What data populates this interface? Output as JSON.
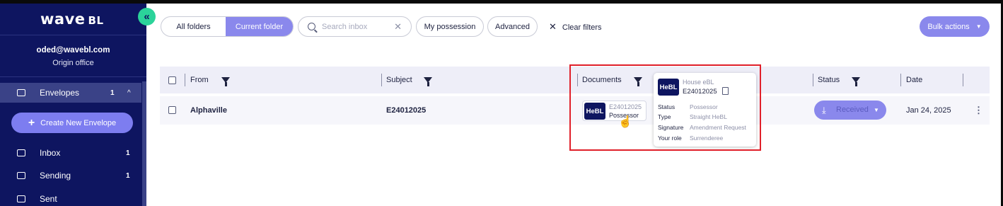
{
  "sidebar": {
    "logo": "wave",
    "logo_suffix": "BL",
    "collapse_icon": "double-chevron-left-icon",
    "user_email": "oded@wavebl.com",
    "user_role": "Origin office",
    "items": [
      {
        "label": "Envelopes",
        "count": "1",
        "icon": "envelope-icon",
        "expanded_indicator": "^"
      },
      {
        "label": "Inbox",
        "count": "1",
        "icon": "inbox-icon"
      },
      {
        "label": "Sending",
        "count": "1",
        "icon": "send-icon"
      },
      {
        "label": "Sent",
        "count": "",
        "icon": "sent-icon"
      }
    ],
    "create_button": "Create New Envelope"
  },
  "toolbar": {
    "all_folders": "All folders",
    "current_folder": "Current folder",
    "search_placeholder": "Search inbox",
    "my_possession": "My possession",
    "advanced": "Advanced",
    "clear_filters": "Clear filters",
    "bulk_actions": "Bulk actions"
  },
  "table": {
    "headers": [
      "From",
      "Subject",
      "Documents",
      "Status",
      "Date"
    ],
    "rows": [
      {
        "from": "Alphaville",
        "subject": "E24012025",
        "document": {
          "badge": "HeBL",
          "number": "E24012025",
          "role": "Possessor"
        },
        "status": "Received",
        "date": "Jan 24, 2025"
      }
    ]
  },
  "tooltip": {
    "badge": "HeBL",
    "kind": "House eBL",
    "number": "E24012025",
    "fields": [
      {
        "key": "Status",
        "value": "Possessor"
      },
      {
        "key": "Type",
        "value": "Straight HeBL"
      },
      {
        "key": "Signature",
        "value": "Amendment Request"
      },
      {
        "key": "Your role",
        "value": "Surrenderee"
      }
    ]
  },
  "colors": {
    "sidebar_bg": "#0e1560",
    "accent": "#8a88ec",
    "collapse_btn": "#2bd39a",
    "highlight": "#e0202a"
  }
}
